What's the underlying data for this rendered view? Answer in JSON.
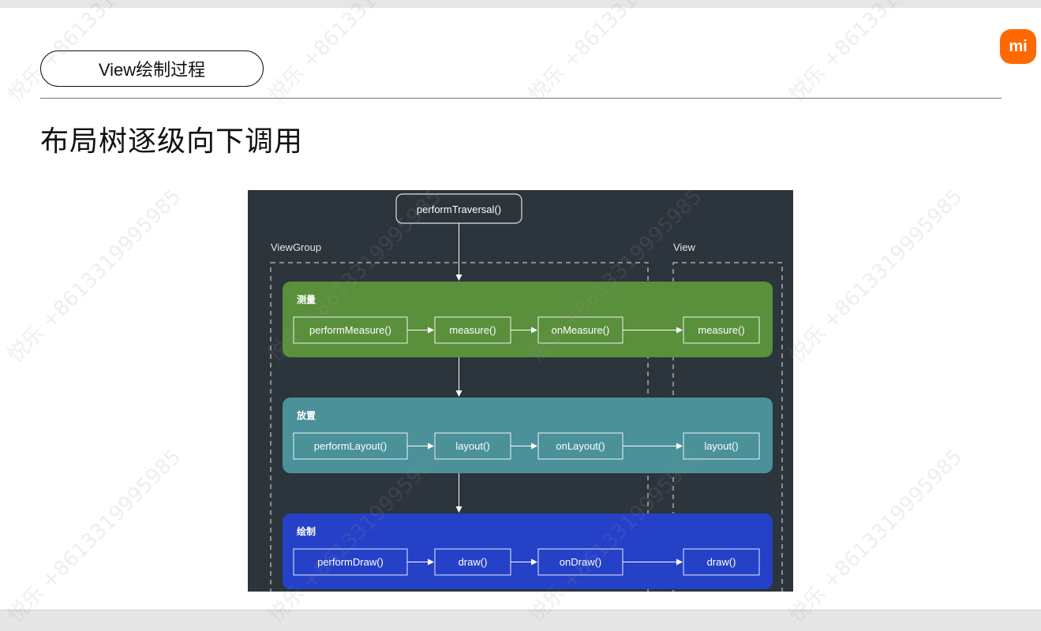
{
  "slide": {
    "tag": "View绘制过程",
    "headline": "布局树逐级向下调用",
    "logo_text": "mi",
    "brand_color": "#ff6900"
  },
  "diagram": {
    "root": "performTraversal()",
    "group_labels": {
      "viewgroup": "ViewGroup",
      "view": "View"
    },
    "stages": [
      {
        "label": "测量",
        "color": "#5a8f3c",
        "steps": [
          "performMeasure()",
          "measure()",
          "onMeasure()"
        ],
        "view_step": "measure()"
      },
      {
        "label": "放置",
        "color": "#4a9199",
        "steps": [
          "performLayout()",
          "layout()",
          "onLayout()"
        ],
        "view_step": "layout()"
      },
      {
        "label": "绘制",
        "color": "#2541c8",
        "steps": [
          "performDraw()",
          "draw()",
          "onDraw()"
        ],
        "view_step": "draw()"
      }
    ],
    "background": "#2c343c"
  },
  "watermark": {
    "text": "悦乐 +8613319995985"
  }
}
